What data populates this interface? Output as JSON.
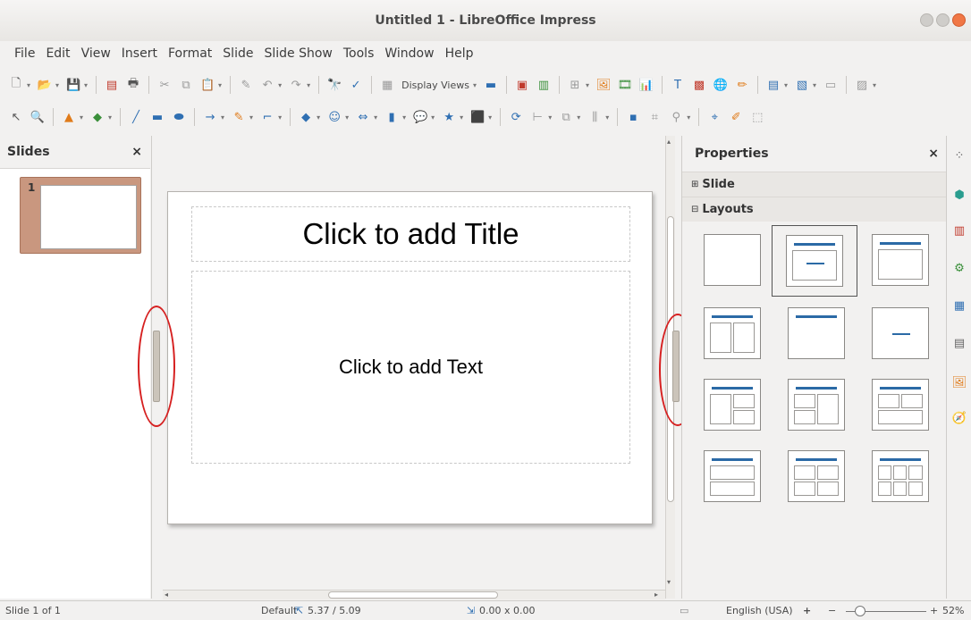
{
  "window": {
    "title": "Untitled 1 - LibreOffice Impress"
  },
  "menu": [
    "File",
    "Edit",
    "View",
    "Insert",
    "Format",
    "Slide",
    "Slide Show",
    "Tools",
    "Window",
    "Help"
  ],
  "toolbar": {
    "display_views_label": "Display Views"
  },
  "slides_panel": {
    "title": "Slides",
    "close": "×",
    "thumb_number": "1"
  },
  "slide": {
    "title_placeholder": "Click to add Title",
    "text_placeholder": "Click to add Text"
  },
  "properties": {
    "title": "Properties",
    "close": "×",
    "sections": [
      {
        "label": "Slide",
        "expander": "⊞"
      },
      {
        "label": "Layouts",
        "expander": "⊟"
      }
    ]
  },
  "status": {
    "slide_position": "Slide 1 of 1",
    "master": "Default",
    "cursor_position": "5.37 / 5.09",
    "object_size": "0.00 x 0.00",
    "language": "English (USA)",
    "zoom_plus": "+",
    "zoom_minus": "−",
    "zoom_in": "+",
    "zoom": "52%"
  },
  "colors": {
    "accent": "#2b6aa6",
    "annotation": "#d62020",
    "slide_selected": "#c9977f"
  }
}
